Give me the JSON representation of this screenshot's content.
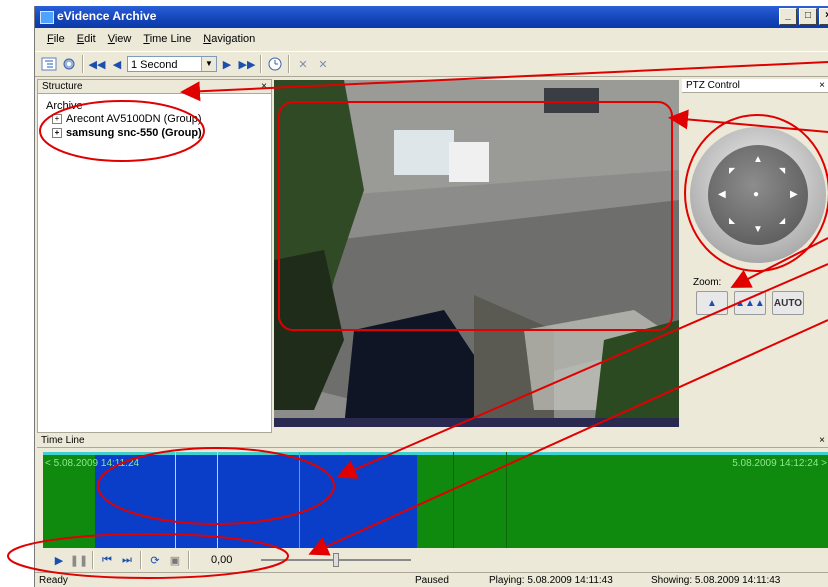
{
  "window": {
    "title": "eVidence Archive",
    "controls": [
      "_",
      "□",
      "×"
    ]
  },
  "menu": [
    "File",
    "Edit",
    "View",
    "Time Line",
    "Navigation"
  ],
  "toolbar": {
    "speed_value": "1 Second"
  },
  "structure": {
    "title": "Structure",
    "root": "Archive",
    "groups": [
      {
        "label": "Arecont AV5100DN (Group)",
        "bold": false
      },
      {
        "label": "samsung snc-550 (Group)",
        "bold": true
      }
    ]
  },
  "ptz": {
    "title": "PTZ Control",
    "zoom_label": "Zoom:",
    "auto_label": "AUTO"
  },
  "timeline": {
    "title": "Time Line",
    "start_label": "< 5.08.2009 14:11:24",
    "end_label": "5.08.2009 14:12:24 >"
  },
  "playback": {
    "value": "0,00"
  },
  "status": {
    "ready": "Ready",
    "state": "Paused",
    "playing": "Playing: 5.08.2009 14:11:43",
    "showing": "Showing: 5.08.2009 14:11:43"
  },
  "colors": {
    "title_bar": "#1444b8",
    "timeline_green": "#0f8a0f",
    "timeline_selection": "#0a3ec8",
    "annotation_red": "#e00000"
  }
}
